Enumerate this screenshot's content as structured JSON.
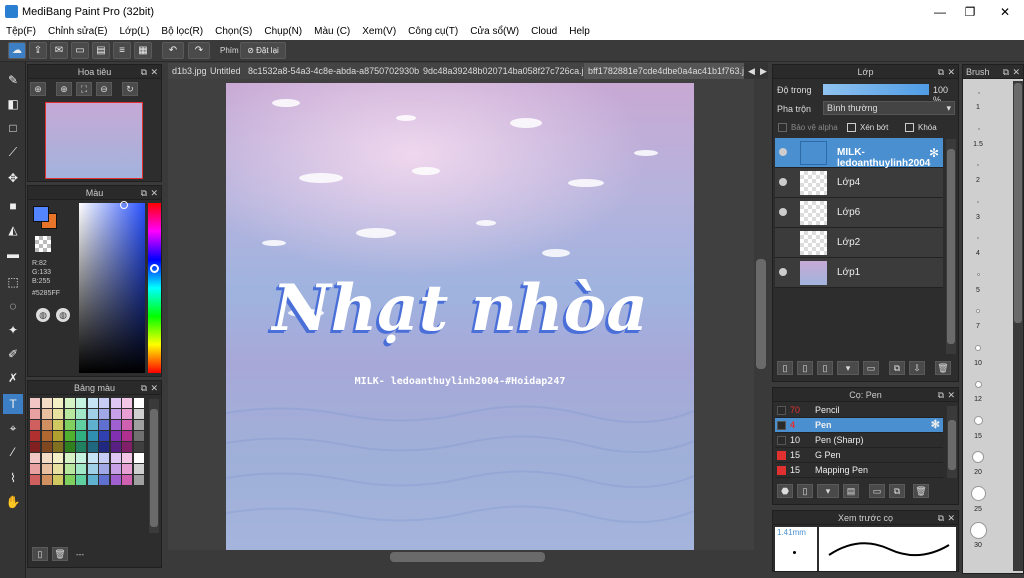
{
  "window": {
    "title": "MediBang Paint Pro (32bit)",
    "minimize": "—",
    "maximize": "❐",
    "close": "✕"
  },
  "menu": [
    "Tệp(F)",
    "Chỉnh sửa(E)",
    "Lớp(L)",
    "Bộ lọc(R)",
    "Chọn(S)",
    "Chụp(N)",
    "Màu (C)",
    "Xem(V)",
    "Công cụ(T)",
    "Cửa sổ(W)",
    "Cloud",
    "Help"
  ],
  "toolbar": {
    "shortcut_label": "Phím",
    "reset_label": "Đặt lại"
  },
  "navigator": {
    "title": "Hoa tiêu"
  },
  "color": {
    "title": "Màu",
    "r": "R:82",
    "g": "G:133",
    "b": "B:255",
    "hex": "#5285FF",
    "primary": "#5285ff",
    "secondary": "#e8742a"
  },
  "palette": {
    "title": "Bảng màu",
    "footer": "---"
  },
  "tabs": [
    "d1b3.jpg",
    "Untitled",
    "8c1532a8-54a3-4c8e-abda-a8750702930b.jpg",
    "9dc48a39248b020714ba058f27c726ca.jpg",
    "bff1782881e7cde4dbe0a4ac41b1f763.jpg"
  ],
  "artwork": {
    "main_text": "Nhạt nhòa",
    "credit": "MILK- ledoanthuylinh2004-#Hoidap247"
  },
  "layer_panel": {
    "title": "Lớp",
    "opacity_label": "Độ trong",
    "opacity_value": "100 %",
    "blend_label": "Pha trộn",
    "blend_value": "Bình thường",
    "protect_alpha": "Bảo vệ alpha",
    "clip": "Xén bớt",
    "lock": "Khóa",
    "layers": [
      "MILK- ledoanthuylinh2004",
      "Lớp4",
      "Lớp6",
      "Lớp2",
      "Lớp1"
    ]
  },
  "brush_panel": {
    "title": "Cọ: Pen",
    "brushes": [
      {
        "size": "70",
        "name": "Pencil",
        "color": "#2a2a2a"
      },
      {
        "size": "4",
        "name": "Pen",
        "color": "#2a2a2a"
      },
      {
        "size": "10",
        "name": "Pen (Sharp)",
        "color": "#2a2a2a"
      },
      {
        "size": "15",
        "name": "G Pen",
        "color": "#e03030"
      },
      {
        "size": "15",
        "name": "Mapping Pen",
        "color": "#e03030"
      }
    ]
  },
  "preview": {
    "title": "Xem trước cọ",
    "size": "1.41mm"
  },
  "brush_size": {
    "title": "Brush",
    "sizes": [
      "1",
      "1.5",
      "2",
      "3",
      "4",
      "5",
      "7",
      "10",
      "12",
      "15",
      "20",
      "25",
      "30"
    ]
  }
}
